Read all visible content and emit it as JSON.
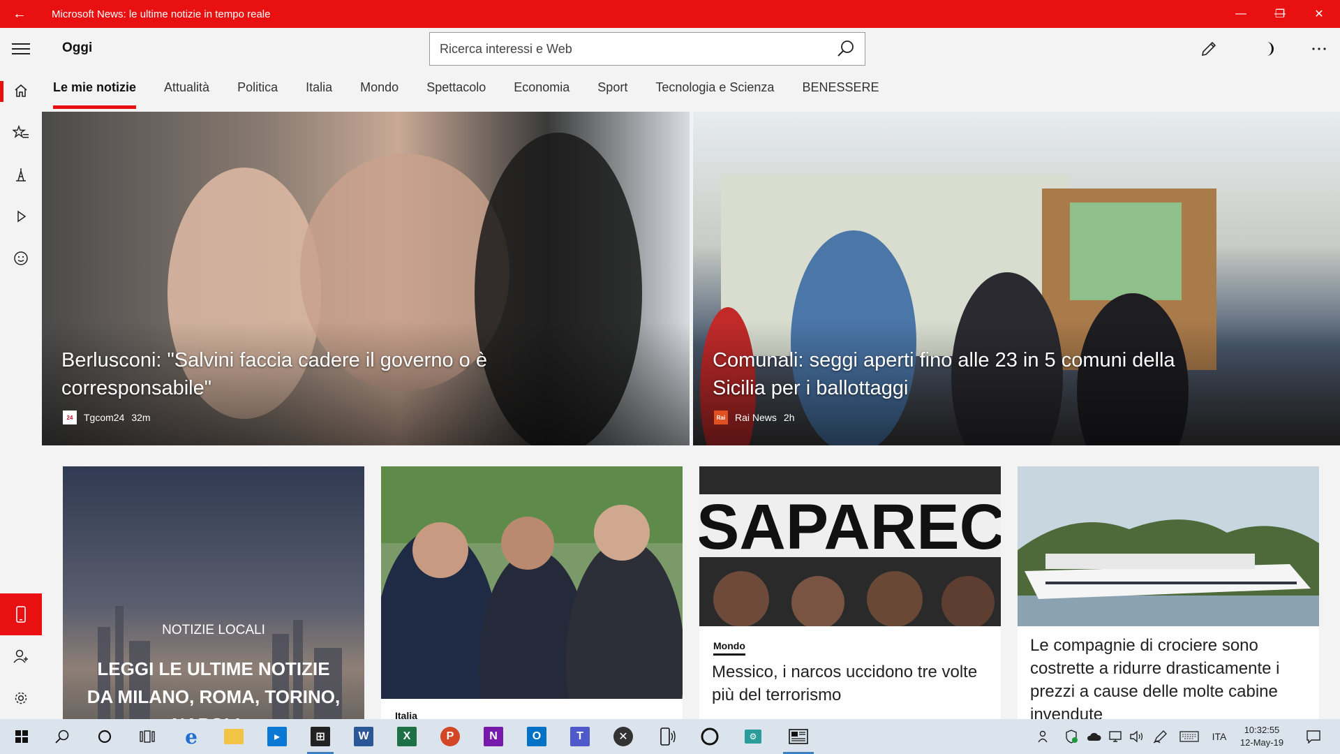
{
  "window": {
    "title": "Microsoft News: le ultime notizie in tempo reale",
    "back_glyph": "←",
    "minimize_glyph": "—",
    "restore_glyph": "❐",
    "close_glyph": "✕",
    "accent": "#e81010"
  },
  "header": {
    "title": "Oggi",
    "search_placeholder": "Ricerca interessi e Web"
  },
  "tabs": [
    {
      "label": "Le mie notizie",
      "active": true
    },
    {
      "label": "Attualità"
    },
    {
      "label": "Politica"
    },
    {
      "label": "Italia"
    },
    {
      "label": "Mondo"
    },
    {
      "label": "Spettacolo"
    },
    {
      "label": "Economia"
    },
    {
      "label": "Sport"
    },
    {
      "label": "Tecnologia e Scienza"
    },
    {
      "label": "BENESSERE"
    }
  ],
  "hero": [
    {
      "title": "Berlusconi: \"Salvini faccia cadere il governo o è corresponsabile\"",
      "source": "Tgcom24",
      "age": "32m",
      "logo_text": "24"
    },
    {
      "title": "Comunali: seggi aperti fino alle 23 in 5 comuni della Sicilia per i ballottaggi",
      "source": "Rai News",
      "age": "2h",
      "logo_text": "Rai"
    }
  ],
  "cards": [
    {
      "overline": "NOTIZIE LOCALI",
      "title": "LEGGI LE ULTIME NOTIZIE DA MILANO, ROMA, TORINO, NAPOLI..."
    },
    {
      "category": "Italia"
    },
    {
      "category": "Mondo",
      "title": "Messico, i narcos uccidono tre volte più del terrorismo",
      "image_text": "SAPARECID"
    },
    {
      "title": "Le compagnie di crociere sono costrette a ridurre drasticamente i prezzi a cause delle molte cabine invendute"
    }
  ],
  "taskbar": {
    "language": "ITA",
    "time": "10:32:55",
    "date": "12-May-19",
    "apps": [
      "windows-start",
      "search",
      "cortana",
      "task-view",
      "edge",
      "file-explorer",
      "app-blue",
      "store",
      "word",
      "excel",
      "powerpoint",
      "onenote",
      "outlook",
      "teams",
      "xbox",
      "your-phone",
      "circle-app",
      "app-teal",
      "news"
    ]
  }
}
